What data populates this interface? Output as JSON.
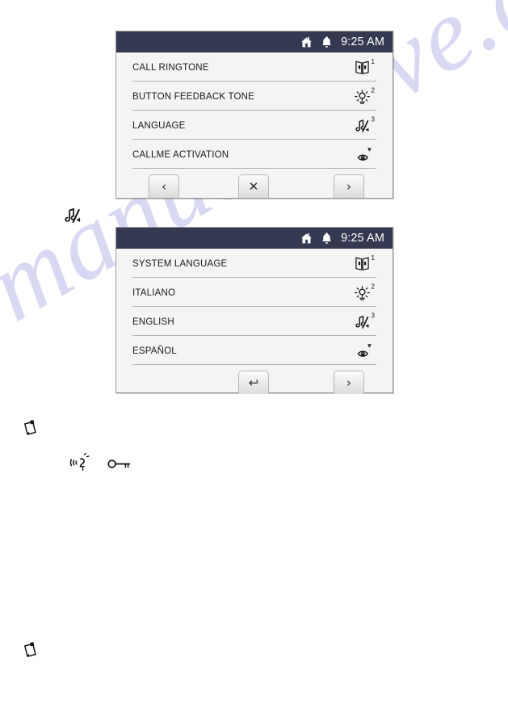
{
  "watermark": {
    "text": "manualshive.com"
  },
  "panels": [
    {
      "id": "settings",
      "name": "settings-menu-screen",
      "statusbar": {
        "home_icon": "home-icon",
        "bell_icon": "bell-icon",
        "time": "9:25 AM"
      },
      "rows": [
        {
          "label": "CALL RINGTONE",
          "icon": "open-book-icon",
          "sup": "1"
        },
        {
          "label": "BUTTON FEEDBACK TONE",
          "icon": "brightness-sun-icon",
          "sup": "2"
        },
        {
          "label": "LANGUAGE",
          "icon": "mute-note-icon",
          "sup": "3"
        },
        {
          "label": "CALLME ACTIVATION",
          "icon": "eye-icon",
          "sup": ""
        }
      ],
      "buttons": [
        {
          "name": "previous-button",
          "glyph": "‹"
        },
        {
          "name": "close-button",
          "glyph": "✕"
        },
        {
          "name": "next-button",
          "glyph": "›"
        }
      ]
    },
    {
      "id": "language",
      "name": "language-menu-screen",
      "statusbar": {
        "home_icon": "home-icon",
        "bell_icon": "bell-icon",
        "time": "9:25 AM"
      },
      "rows": [
        {
          "label": "SYSTEM LANGUAGE",
          "icon": "open-book-icon",
          "sup": "1"
        },
        {
          "label": "ITALIANO",
          "icon": "brightness-sun-icon",
          "sup": "2"
        },
        {
          "label": "ENGLISH",
          "icon": "mute-note-icon",
          "sup": "3"
        },
        {
          "label": "ESPAÑOL",
          "icon": "eye-icon",
          "sup": ""
        }
      ],
      "buttons": [
        {
          "name": "back-button",
          "glyph": "↩"
        },
        {
          "name": "next-button",
          "glyph": "›"
        }
      ]
    }
  ],
  "margin_icons": [
    {
      "name": "mute-note-icon",
      "meaning": "language"
    },
    {
      "name": "note-clipboard-icon",
      "meaning": "note"
    },
    {
      "name": "ringing-bell-icon",
      "meaning": "call tone"
    },
    {
      "name": "key-icon",
      "meaning": "door release"
    },
    {
      "name": "note-clipboard-icon",
      "meaning": "note"
    }
  ],
  "colors": {
    "statusbar_bg": "#343850",
    "panel_bg": "#f4f4f4",
    "panel_border": "#9b9b9b",
    "row_divider": "#b3b3b3",
    "text": "#1b1b1b",
    "status_text": "#ffffff",
    "watermark": "#d9d8f2"
  }
}
